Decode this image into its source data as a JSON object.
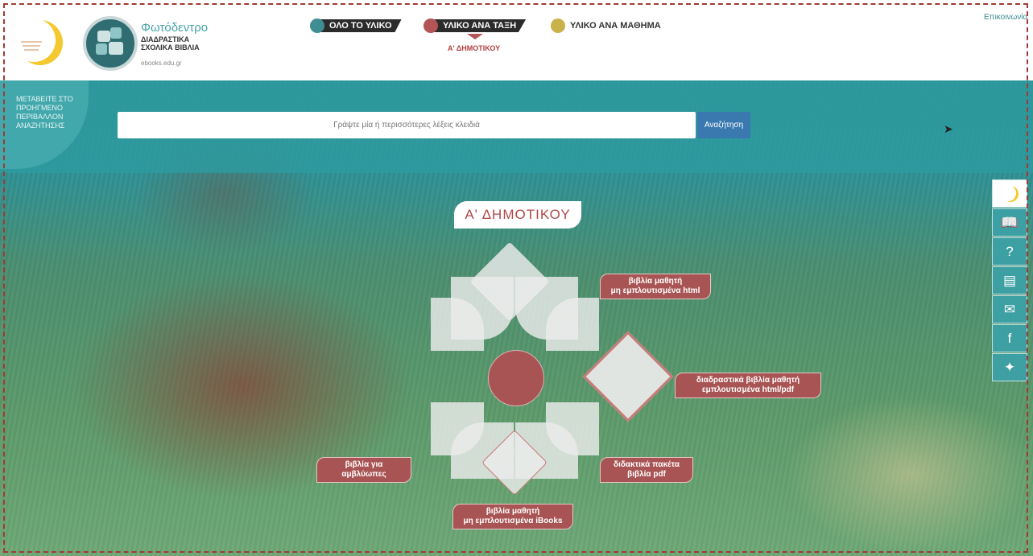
{
  "header": {
    "brand_title": "Φωτόδεντρο",
    "brand_sub": "ΔΙΑΔΡΑΣΤΙΚΑ ΣΧΟΛΙΚΑ ΒΙΒΛΙΑ",
    "brand_url": "ebooks.edu.gr",
    "nav": [
      {
        "label": "ΟΛΟ ΤΟ ΥΛΙΚΟ",
        "color": "#3f8e93"
      },
      {
        "label": "ΥΛΙΚΟ ΑΝΑ ΤΑΞΗ",
        "color": "#b35456"
      },
      {
        "label": "ΥΛΙΚΟ ΑΝΑ ΜΑΘΗΜΑ",
        "color": "#c9b24a"
      }
    ],
    "nav_sub": "Α' ΔΗΜΟΤΙΚΟΥ",
    "contact": "Επικοινωνία"
  },
  "search": {
    "prev_label": "ΜΕΤΑΒΕΙΤΕ ΣΤΟ ΠΡΟΗΓΜΕΝΟ ΠΕΡΙΒΑΛΛΟΝ ΑΝΑΖΗΤΗΣΗΣ",
    "placeholder": "Γράψτε μία ή περισσότερες λέξεις κλειδιά",
    "button": "Αναζήτηση"
  },
  "main": {
    "grade_title": "Α' ΔΗΜΟΤΙΚΟΥ",
    "tags": [
      {
        "line1": "βιβλία μαθητή",
        "line2": "μη εμπλουτισμένα html"
      },
      {
        "line1": "διαδραστικά βιβλία μαθητή",
        "line2": "εμπλουτισμένα html/pdf"
      },
      {
        "line1": "βιβλία για αμβλύωπες",
        "line2": ""
      },
      {
        "line1": "διδακτικά πακέτα",
        "line2": "βιβλία pdf"
      },
      {
        "line1": "βιβλία μαθητή",
        "line2": "μη εμπλουτισμένα iBooks"
      }
    ]
  },
  "side_icons": [
    "photodentro-logo-icon",
    "book-icon",
    "help-icon",
    "document-icon",
    "mail-icon",
    "facebook-icon",
    "twitter-icon"
  ],
  "colors": {
    "accent_red": "#a95454",
    "teal": "#2f9194",
    "blue_button": "#3a79b0"
  }
}
